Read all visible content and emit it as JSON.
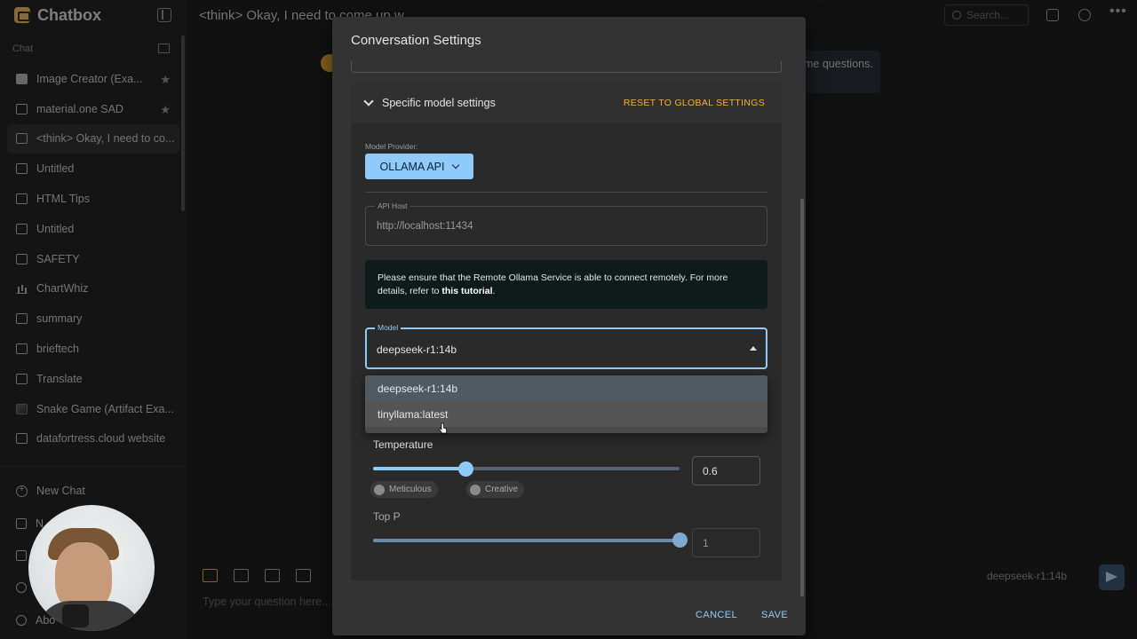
{
  "app": {
    "name": "Chatbox",
    "conversation_title": "<think> Okay, I need to come up w"
  },
  "search": {
    "placeholder": "Search..."
  },
  "sidebar": {
    "section_label": "Chat",
    "items": [
      {
        "label": "Image Creator (Exa...",
        "icon": "image-icon",
        "starred": true
      },
      {
        "label": "material.one SAD",
        "icon": "chat-icon",
        "starred": true
      },
      {
        "label": "<think> Okay, I need to co...",
        "icon": "chat-icon",
        "active": true
      },
      {
        "label": "Untitled",
        "icon": "chat-icon"
      },
      {
        "label": "HTML Tips",
        "icon": "chat-icon"
      },
      {
        "label": "Untitled",
        "icon": "chat-icon"
      },
      {
        "label": "SAFETY",
        "icon": "chat-icon"
      },
      {
        "label": "ChartWhiz",
        "icon": "chart-icon"
      },
      {
        "label": "summary",
        "icon": "chat-icon"
      },
      {
        "label": "brieftech",
        "icon": "chat-icon"
      },
      {
        "label": "Translate",
        "icon": "chat-icon"
      },
      {
        "label": "Snake Game (Artifact Exa...",
        "icon": "thumbnail-icon"
      },
      {
        "label": "datafortress.cloud website",
        "icon": "chat-icon"
      }
    ],
    "new_chat": "New Chat",
    "partial_item_1": "N",
    "partial_item_2": "Abo"
  },
  "main": {
    "message_fragment": "me questions.",
    "input_placeholder": "Type your question here...",
    "current_model": "deepseek-r1:14b"
  },
  "dialog": {
    "title": "Conversation Settings",
    "section_title": "Specific model settings",
    "reset_label": "RESET TO GLOBAL SETTINGS",
    "provider_label": "Model Provider:",
    "provider_value": "OLLAMA API",
    "api_host_label": "API Host",
    "api_host_value": "http://localhost:11434",
    "info_text": "Please ensure that the Remote Ollama Service is able to connect remotely. For more details, refer to ",
    "info_link": "this tutorial",
    "info_end": ".",
    "model_label": "Model",
    "model_value": "deepseek-r1:14b",
    "model_options": [
      "deepseek-r1:14b",
      "tinyllama:latest"
    ],
    "temperature_label": "Temperature",
    "temperature_value": "0.6",
    "temperature_fraction": 0.3,
    "chip_meticulous": "Meticulous",
    "chip_creative": "Creative",
    "top_p_label": "Top P",
    "top_p_value": "1",
    "top_p_fraction": 1.0,
    "cancel": "CANCEL",
    "save": "SAVE"
  },
  "colors": {
    "accent": "#90caf9",
    "warning": "#f2b233",
    "dialog_bg": "#333333"
  }
}
